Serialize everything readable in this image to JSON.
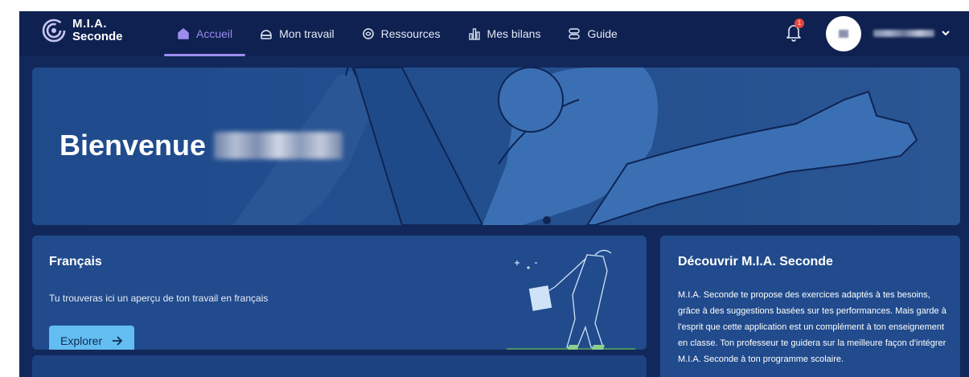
{
  "app": {
    "logo_line1": "M.I.A.",
    "logo_line2": "Seconde"
  },
  "nav": {
    "items": [
      {
        "label": "Accueil",
        "icon": "home-icon",
        "active": true
      },
      {
        "label": "Mon travail",
        "icon": "briefcase-icon",
        "active": false
      },
      {
        "label": "Ressources",
        "icon": "resources-icon",
        "active": false
      },
      {
        "label": "Mes bilans",
        "icon": "bar-chart-icon",
        "active": false
      },
      {
        "label": "Guide",
        "icon": "signpost-icon",
        "active": false
      }
    ]
  },
  "notifications": {
    "count": "1",
    "icon": "bell-icon"
  },
  "user": {
    "avatar_icon": "avatar-icon",
    "menu_icon": "chevron-down-icon"
  },
  "hero": {
    "title": "Bienvenue"
  },
  "francais_card": {
    "title": "Français",
    "description": "Tu trouveras ici un aperçu de ton travail en français",
    "button_label": "Explorer"
  },
  "mia_card": {
    "title": "Découvrir M.I.A. Seconde",
    "text": "M.I.A. Seconde te propose des exercices adaptés à tes besoins, grâce à des suggestions basées sur tes performances. Mais garde à l'esprit que cette application est un complément à ton enseignement en classe. Ton professeur te guidera sur la meilleure façon d'intégrer M.I.A. Seconde à ton programme scolaire."
  },
  "colors": {
    "background": "#12285a",
    "topbar": "#0f2150",
    "accent": "#9d8cf0",
    "button": "#63bdf0",
    "card": "#214b8c"
  }
}
